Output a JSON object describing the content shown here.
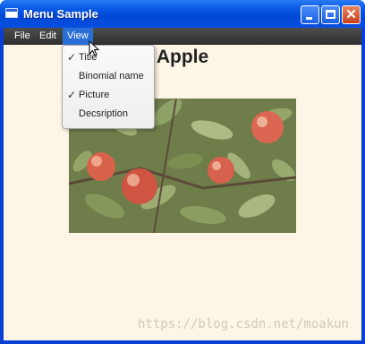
{
  "window": {
    "title": "Menu Sample",
    "accent": "#0054e3",
    "content_background": "#fdf5e6"
  },
  "menubar": {
    "items": [
      {
        "label": "File"
      },
      {
        "label": "Edit"
      },
      {
        "label": "View",
        "active": true
      }
    ]
  },
  "view_menu": {
    "items": [
      {
        "label": "Title",
        "checked": true,
        "check": "✓"
      },
      {
        "label": "Binomial name",
        "checked": false,
        "check": ""
      },
      {
        "label": "Picture",
        "checked": true,
        "check": "✓"
      },
      {
        "label": "Decsription",
        "checked": false,
        "check": ""
      }
    ]
  },
  "content": {
    "heading": "Apple",
    "picture": "apple-tree-photo"
  },
  "watermark": "https://blog.csdn.net/moakun"
}
